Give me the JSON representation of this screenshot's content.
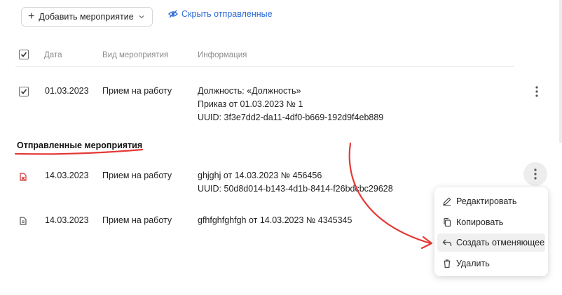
{
  "toolbar": {
    "add_label": "Добавить мероприятие",
    "hide_sent_label": "Скрыть отправленные"
  },
  "table": {
    "headers": {
      "date": "Дата",
      "type": "Вид мероприятия",
      "info": "Информация"
    },
    "rows": [
      {
        "date": "01.03.2023",
        "type": "Прием на работу",
        "info": [
          "Должность: «Должность»",
          "Приказ от 01.03.2023 № 1",
          "UUID: 3f3e7dd2-da11-4df0-b669-192d9f4eb889"
        ]
      }
    ]
  },
  "sent": {
    "title": "Отправленные мероприятия",
    "rows": [
      {
        "date": "14.03.2023",
        "type": "Прием на работу",
        "info": [
          "ghjghj от 14.03.2023 № 456456",
          "UUID: 50d8d014-b143-4d1b-8414-f26bdcbc29628"
        ],
        "icon": "rejected-document-icon"
      },
      {
        "date": "14.03.2023",
        "type": "Прием на работу",
        "info": [
          "gfhfghfghfgh от 14.03.2023 № 4345345"
        ],
        "icon": "document-icon"
      }
    ]
  },
  "context_menu": {
    "items": [
      {
        "label": "Редактировать",
        "icon": "pencil-icon"
      },
      {
        "label": "Копировать",
        "icon": "copy-icon"
      },
      {
        "label": "Создать отменяющее",
        "icon": "undo-icon"
      },
      {
        "label": "Удалить",
        "icon": "trash-icon"
      }
    ]
  },
  "colors": {
    "link": "#2c6bd6",
    "annotation": "#e53935",
    "rejected": "#d32f2f"
  }
}
